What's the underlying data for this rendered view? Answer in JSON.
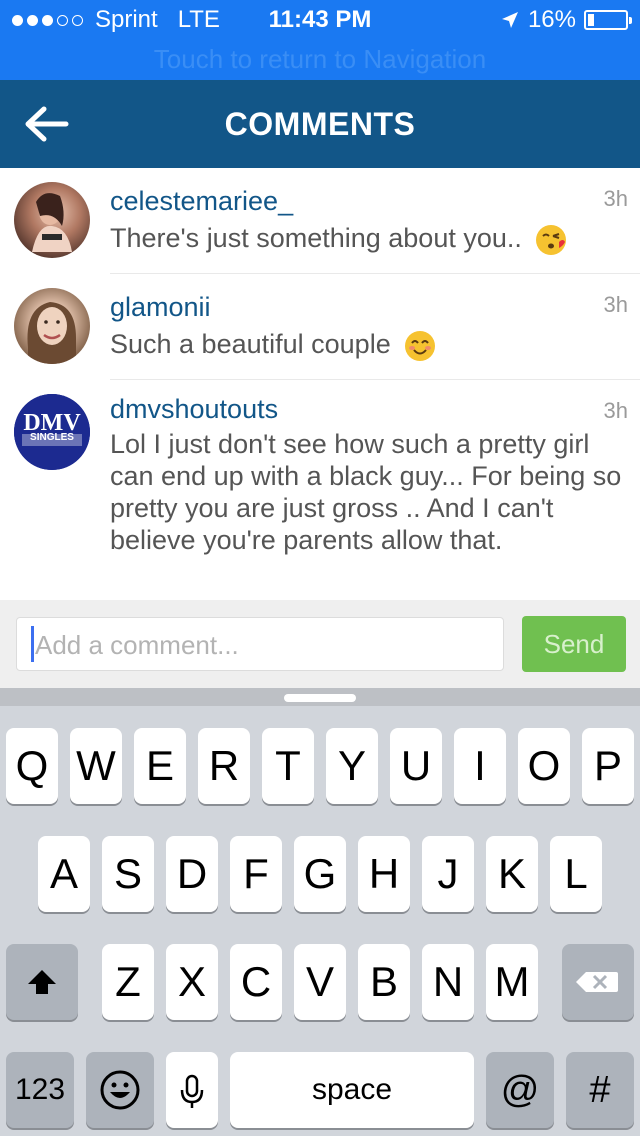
{
  "status_bar": {
    "carrier": "Sprint",
    "network": "LTE",
    "time": "11:43 PM",
    "battery_percent": "16%",
    "battery_level": 0.16,
    "return_banner": "Touch to return to Navigation"
  },
  "header": {
    "title": "COMMENTS"
  },
  "comments": [
    {
      "username": "celestemariee_",
      "time": "3h",
      "text": "There's just something about you..",
      "emoji": "kissing-face-emoji"
    },
    {
      "username": "glamonii",
      "time": "3h",
      "text": "Such a beautiful couple",
      "emoji": "smiling-face-emoji"
    },
    {
      "username": "dmvshoutouts",
      "time": "3h",
      "text": "Lol I just don't see how such a pretty girl can end up with a black guy... For being so pretty you are just gross .. And I can't believe you're parents allow that.",
      "avatar_text": "DMV",
      "avatar_subtext": "SINGLES"
    }
  ],
  "comment_box": {
    "placeholder": "Add a comment...",
    "send_label": "Send"
  },
  "keyboard": {
    "row1": [
      "Q",
      "W",
      "E",
      "R",
      "T",
      "Y",
      "U",
      "I",
      "O",
      "P"
    ],
    "row2": [
      "A",
      "S",
      "D",
      "F",
      "G",
      "H",
      "J",
      "K",
      "L"
    ],
    "row3": [
      "Z",
      "X",
      "C",
      "V",
      "B",
      "N",
      "M"
    ],
    "numbers_label": "123",
    "space_label": "space",
    "at_label": "@",
    "hash_label": "#"
  },
  "colors": {
    "status_bar": "#1a79f2",
    "header": "#125688",
    "username": "#125688",
    "send_button": "#70c050"
  }
}
